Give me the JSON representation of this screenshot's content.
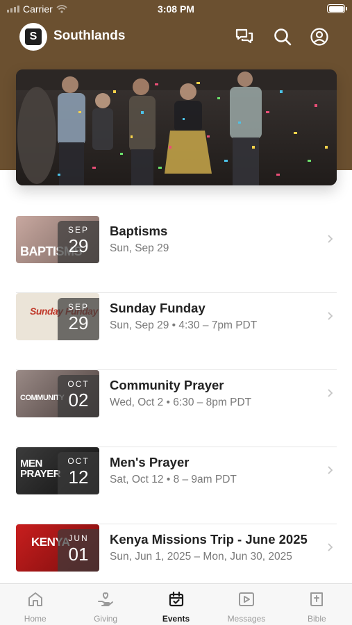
{
  "status_bar": {
    "carrier": "Carrier",
    "time": "3:08 PM"
  },
  "app_bar": {
    "title": "Southlands",
    "logo_letter": "S",
    "icons": [
      "chat-icon",
      "search-icon",
      "profile-icon"
    ]
  },
  "colors": {
    "header_brown": "#6b5030",
    "active_tab": "#1a1a1a",
    "inactive_tab": "#9a9a9a"
  },
  "events": [
    {
      "title": "Baptisms",
      "subtitle": "Sun, Sep 29",
      "month": "SEP",
      "day": "29",
      "thumb_text": "BAPTISMS"
    },
    {
      "title": "Sunday Funday",
      "subtitle": "Sun, Sep 29 • 4:30 – 7pm PDT",
      "month": "SEP",
      "day": "29",
      "thumb_text": "Sunday Funday"
    },
    {
      "title": "Community Prayer",
      "subtitle": "Wed, Oct 2 • 6:30 – 8pm PDT",
      "month": "OCT",
      "day": "02",
      "thumb_text": "COMMUNITY"
    },
    {
      "title": "Men's Prayer",
      "subtitle": "Sat, Oct 12 • 8 – 9am PDT",
      "month": "OCT",
      "day": "12",
      "thumb_text": "MEN PRAYER"
    },
    {
      "title": "Kenya Missions Trip - June 2025",
      "subtitle": "Sun, Jun 1, 2025 – Mon, Jun 30, 2025",
      "month": "JUN",
      "day": "01",
      "thumb_text": "KENYA"
    }
  ],
  "tabs": [
    {
      "label": "Home",
      "icon": "home-icon",
      "active": false
    },
    {
      "label": "Giving",
      "icon": "giving-icon",
      "active": false
    },
    {
      "label": "Events",
      "icon": "calendar-icon",
      "active": true
    },
    {
      "label": "Messages",
      "icon": "play-icon",
      "active": false
    },
    {
      "label": "Bible",
      "icon": "bible-icon",
      "active": false
    }
  ]
}
